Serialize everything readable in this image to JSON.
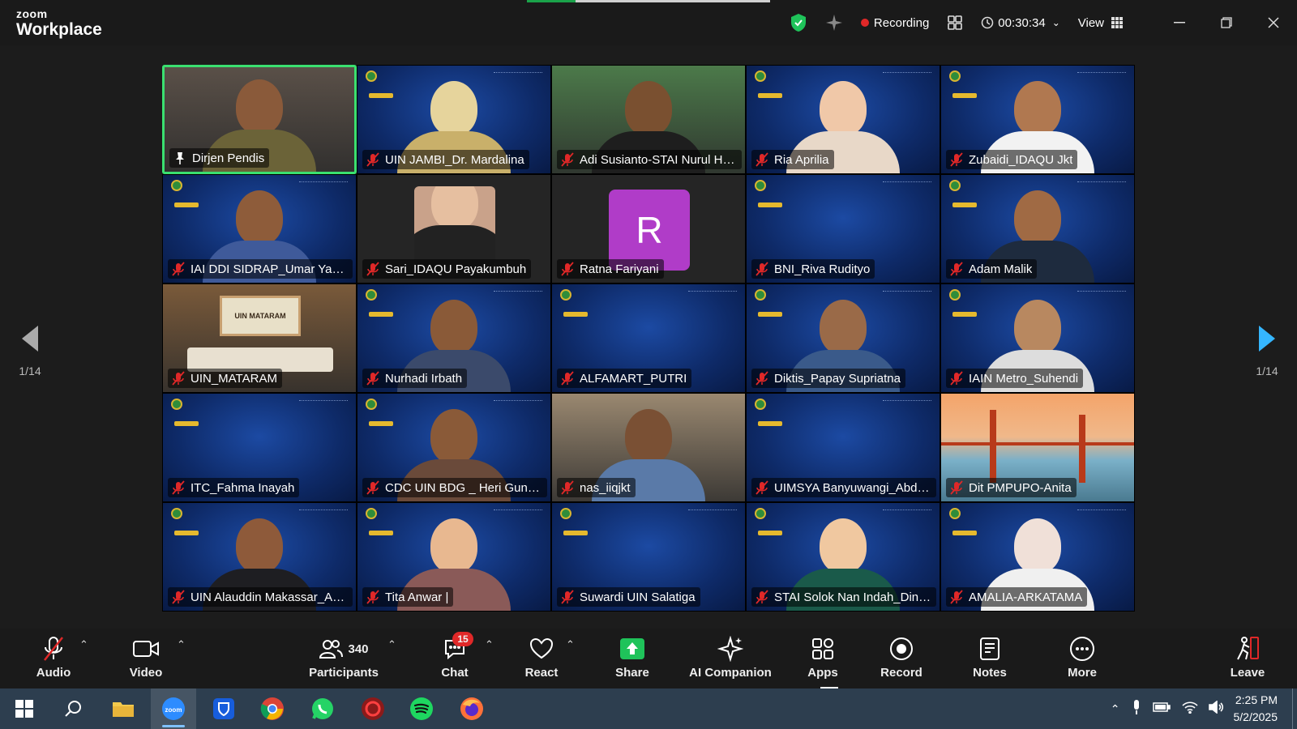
{
  "titlebar": {
    "brand_top": "zoom",
    "brand_bottom": "Workplace",
    "recording_label": "Recording",
    "timer": "00:30:34",
    "view_label": "View"
  },
  "paging": {
    "left": "1/14",
    "right": "1/14"
  },
  "tiles": [
    {
      "name": "Dirjen Pendis",
      "type": "cam",
      "bg": "#5a5048",
      "skin": "#8a5a3a",
      "shirt": "#6b6338",
      "active": true,
      "muted": false
    },
    {
      "name": "UIN JAMBI_Dr. Mardalina",
      "type": "cam",
      "bg": "blue",
      "skin": "#e6d49c",
      "shirt": "#c9b06a",
      "muted": true
    },
    {
      "name": "Adi Susianto-STAI Nurul Hu...",
      "type": "cam",
      "bg": "#4c7a4a",
      "skin": "#7a5030",
      "shirt": "#1e1e1e",
      "muted": true
    },
    {
      "name": "Ria Aprilia",
      "type": "cam",
      "bg": "blue",
      "skin": "#f0c8a8",
      "shirt": "#e8d8c8",
      "muted": true
    },
    {
      "name": "Zubaidi_IDAQU Jkt",
      "type": "cam",
      "bg": "blue",
      "skin": "#b07850",
      "shirt": "#f2f2f2",
      "muted": true
    },
    {
      "name": "IAI DDI SIDRAP_Umar Yahya",
      "type": "cam",
      "bg": "blue",
      "skin": "#8e5c3a",
      "shirt": "#3f5a9a",
      "muted": true
    },
    {
      "name": "Sari_IDAQU Payakumbuh",
      "type": "photo",
      "bg": "dark",
      "skin": "#e6bfa0",
      "shirt": "#222",
      "muted": true
    },
    {
      "name": "Ratna Fariyani",
      "type": "avatar",
      "bg": "dark",
      "letter": "R",
      "avatar_color": "#b03cc8",
      "muted": true
    },
    {
      "name": "BNI_Riva Rudityo",
      "type": "empty",
      "bg": "blue",
      "muted": true
    },
    {
      "name": "Adam Malik",
      "type": "cam",
      "bg": "blue",
      "skin": "#a06a44",
      "shirt": "#1e2b3e",
      "muted": true
    },
    {
      "name": "UIN_MATARAM",
      "type": "room",
      "bg": "#7a5a3a",
      "muted": true
    },
    {
      "name": "Nurhadi Irbath",
      "type": "cam",
      "bg": "blue",
      "skin": "#8a5a38",
      "shirt": "#3b4a6b",
      "muted": true
    },
    {
      "name": "ALFAMART_PUTRI",
      "type": "empty",
      "bg": "blue",
      "muted": true
    },
    {
      "name": "Diktis_Papay Supriatna",
      "type": "cam",
      "bg": "blue",
      "skin": "#9a6a48",
      "shirt": "#3a5a8a",
      "muted": true
    },
    {
      "name": "IAIN Metro_Suhendi",
      "type": "cam",
      "bg": "blue",
      "skin": "#b88860",
      "shirt": "#ddd",
      "muted": true
    },
    {
      "name": "ITC_Fahma Inayah",
      "type": "empty",
      "bg": "blue",
      "muted": true
    },
    {
      "name": "CDC UIN BDG _ Heri Gunaw...",
      "type": "cam",
      "bg": "blue",
      "skin": "#8a5a38",
      "shirt": "#6a4a3a",
      "muted": true
    },
    {
      "name": "nas_iiqjkt",
      "type": "cam",
      "bg": "#9a8870",
      "skin": "#7a5034",
      "shirt": "#5a7aa8",
      "muted": true
    },
    {
      "name": "UIMSYA Banyuwangi_Abdi F...",
      "type": "empty",
      "bg": "blue",
      "muted": true
    },
    {
      "name": "Dit PMPUPO-Anita",
      "type": "bridge",
      "bg": "sunset",
      "muted": true
    },
    {
      "name": "UIN Alauddin Makassar_Ah...",
      "type": "cam",
      "bg": "blue",
      "skin": "#8e5a3a",
      "shirt": "#1e1e22",
      "muted": true
    },
    {
      "name": "Tita Anwar |",
      "type": "cam",
      "bg": "blue",
      "skin": "#e8b890",
      "shirt": "#8a5a58",
      "muted": true
    },
    {
      "name": "Suwardi UIN Salatiga",
      "type": "empty",
      "bg": "blue",
      "muted": true
    },
    {
      "name": "STAI Solok Nan Indah_Dina ...",
      "type": "cam",
      "bg": "blue",
      "skin": "#f0c8a0",
      "shirt": "#1a5a4a",
      "muted": true
    },
    {
      "name": "AMALIA-ARKATAMA",
      "type": "cam",
      "bg": "blue",
      "skin": "#f0e0d8",
      "shirt": "#f0f0f0",
      "muted": true
    }
  ],
  "toolbar": {
    "audio": "Audio",
    "video": "Video",
    "participants_count": "340",
    "participants": "Participants",
    "chat": "Chat",
    "chat_badge": "15",
    "react": "React",
    "share": "Share",
    "ai_companion": "AI Companion",
    "apps": "Apps",
    "record": "Record",
    "notes": "Notes",
    "more": "More",
    "leave": "Leave"
  },
  "taskbar": {
    "time": "2:25 PM",
    "date": "5/2/2025",
    "apps": [
      "start-icon",
      "search-icon",
      "file-explorer-icon",
      "zoom-icon",
      "bitwarden-icon",
      "chrome-icon",
      "whatsapp-icon",
      "app-red-icon",
      "spotify-icon",
      "firefox-icon"
    ]
  },
  "colors": {
    "accent_green": "#3ae070",
    "record_red": "#e02828",
    "share_green": "#1fc35a",
    "taskbar": "#2d3e4f"
  }
}
